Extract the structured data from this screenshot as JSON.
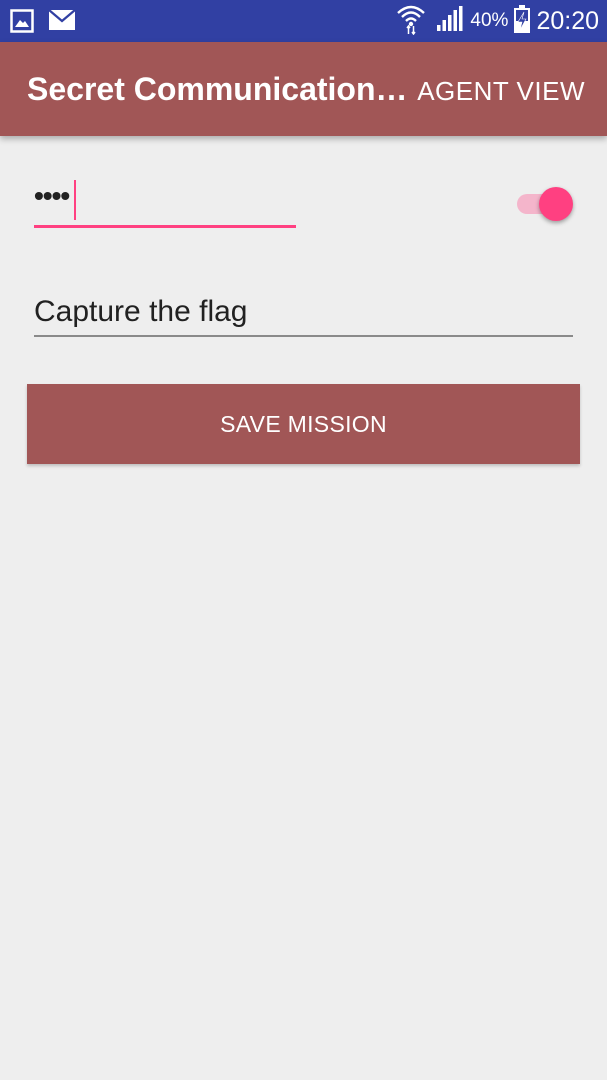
{
  "status_bar": {
    "battery_percent": "40%",
    "time": "20:20",
    "left_icons": [
      "gallery-icon",
      "mail-icon"
    ],
    "right_icons": [
      "wifi-icon",
      "signal-icon",
      "battery-charging-icon"
    ]
  },
  "app_bar": {
    "title": "Secret Communication…",
    "action": "AGENT VIEW",
    "color": "#a15656"
  },
  "form": {
    "password_value": "••••",
    "toggle_on": true,
    "mission_value": "Capture the flag",
    "accent_color": "#ff4081"
  },
  "actions": {
    "save_label": "SAVE MISSION"
  }
}
